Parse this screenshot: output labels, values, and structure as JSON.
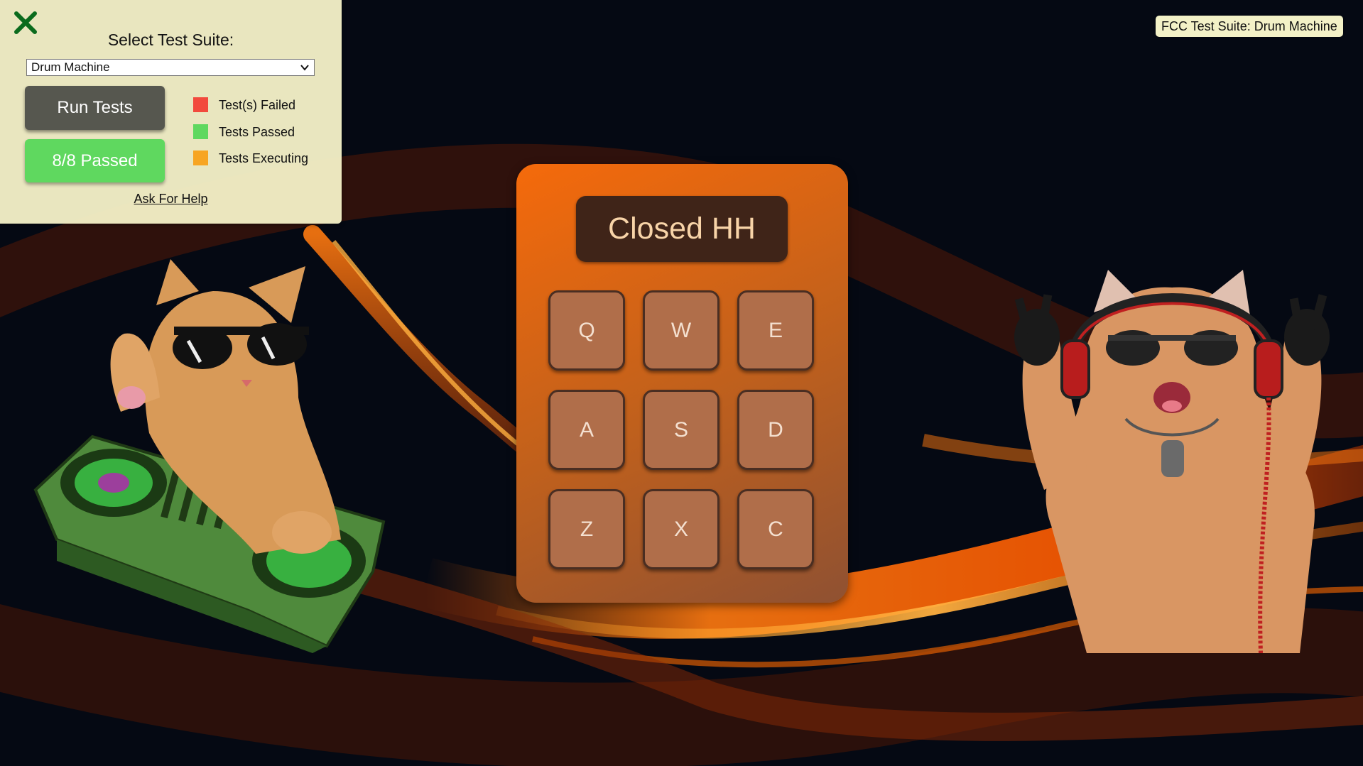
{
  "test_panel": {
    "title": "Select Test Suite:",
    "selected_suite": "Drum Machine",
    "run_tests_label": "Run Tests",
    "result_label": "8/8 Passed",
    "legend": [
      {
        "label": "Test(s) Failed",
        "color": "#f24a3d"
      },
      {
        "label": "Tests Passed",
        "color": "#5fd85f"
      },
      {
        "label": "Tests Executing",
        "color": "#f7a522"
      }
    ],
    "help_link": "Ask For Help"
  },
  "title_badge": "FCC Test Suite: Drum Machine",
  "drum_machine": {
    "display_text": "Closed HH",
    "pads": [
      "Q",
      "W",
      "E",
      "A",
      "S",
      "D",
      "Z",
      "X",
      "C"
    ]
  },
  "colors": {
    "panel_bg": "#f5f2c8",
    "run_button": "#56574f",
    "passed_button": "#5fd85f",
    "machine_orange": "#f56a0b",
    "pad": "#b06e4a",
    "display_bg": "#3f2418"
  },
  "icons": {
    "close": "close-icon",
    "dropdown": "chevron-down-icon"
  }
}
